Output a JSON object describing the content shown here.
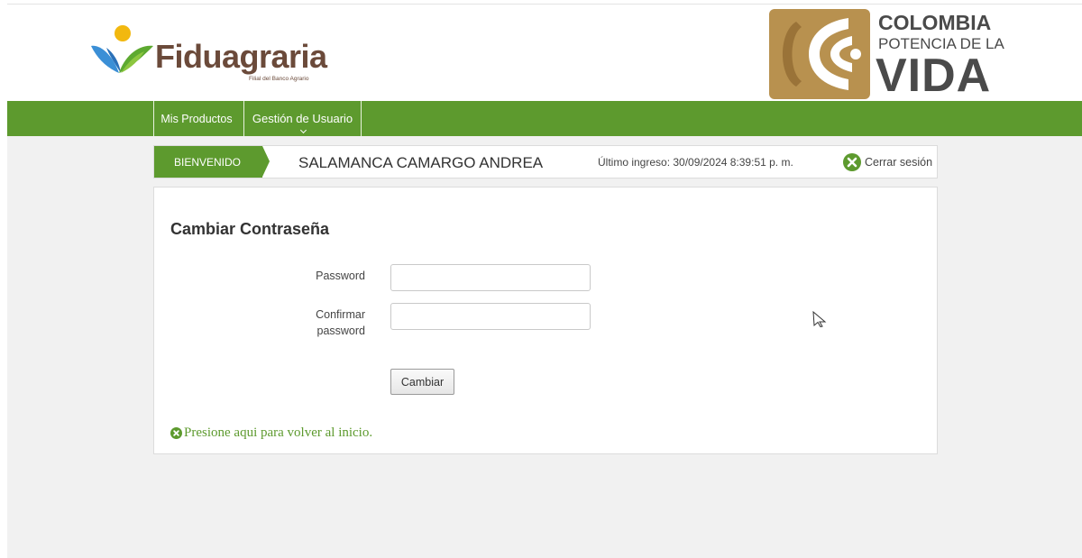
{
  "header": {
    "brand_name": "Fiduagraria",
    "brand_tagline": "Filial del Banco Agrario",
    "partner_logo": {
      "line1": "COLOMBIA",
      "line2": "POTENCIA DE LA",
      "line3": "VIDA"
    }
  },
  "navbar": {
    "items": [
      {
        "label": "Mis Productos"
      },
      {
        "label": "Gestión de Usuario",
        "icon": "chevron-down-icon"
      }
    ]
  },
  "welcome": {
    "tag": "BIENVENIDO",
    "user_name": "SALAMANCA CAMARGO ANDREA",
    "last_login": "Último ingreso: 30/09/2024 8:39:51 p. m.",
    "logout_label": "Cerrar sesión",
    "logout_icon": "close-circle-icon"
  },
  "form": {
    "title": "Cambiar Contraseña",
    "password_label": "Password",
    "password_value": "",
    "confirm_label_line1": "Confirmar",
    "confirm_label_line2": "password",
    "confirm_value": "",
    "submit_label": "Cambiar",
    "back_link": "Presione aqui para volver al inicio.",
    "back_icon": "arrow-circle-icon"
  },
  "colors": {
    "brand_green": "#5d9a2e",
    "logo_brown": "#6b4a3a",
    "gold": "#b8914f"
  }
}
